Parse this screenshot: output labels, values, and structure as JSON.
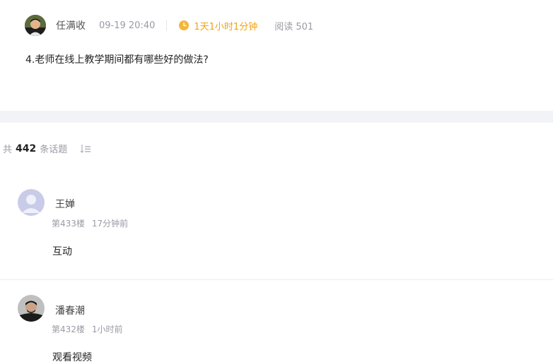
{
  "post": {
    "author_name": "任满收",
    "time": "09-19 20:40",
    "duration": "1天1小时1分钟",
    "reads": "阅读 501",
    "question": "4.老师在线上教学期间都有哪些好的做法?"
  },
  "topics": {
    "prefix": "共",
    "count": "442",
    "suffix": "条话题"
  },
  "replies": [
    {
      "name": "王婵",
      "floor": "第433楼",
      "time": "17分钟前",
      "body": "互动"
    },
    {
      "name": "潘春潮",
      "floor": "第432楼",
      "time": "1小时前",
      "body": "观看视频"
    }
  ],
  "colors": {
    "accent": "#f1a30f",
    "muted": "#9a9aa5",
    "band": "#f2f3f7"
  }
}
